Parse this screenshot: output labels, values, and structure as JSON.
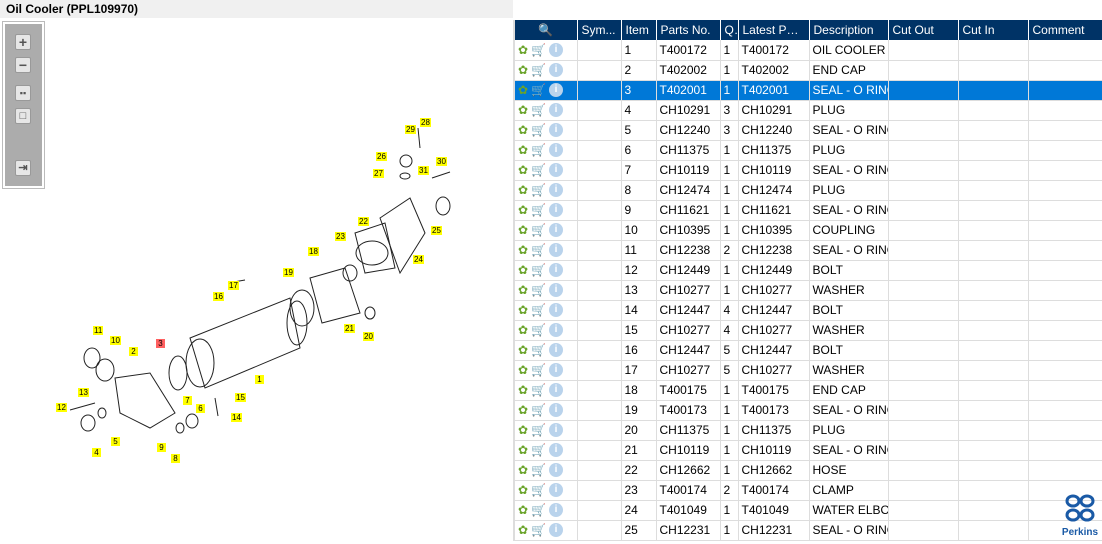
{
  "title": "Oil Cooler (PPL109970)",
  "toolbar": [
    "zoom-in",
    "zoom-out",
    "fit-all",
    "fit-window",
    "export"
  ],
  "callouts": [
    "28",
    "29",
    "26",
    "27",
    "31",
    "30",
    "22",
    "25",
    "23",
    "24",
    "18",
    "19",
    "17",
    "16",
    "21",
    "20",
    "11",
    "10",
    "3",
    "2",
    "1",
    "13",
    "12",
    "7",
    "15",
    "6",
    "5",
    "14",
    "9",
    "4",
    "8"
  ],
  "columns": [
    "",
    "Sym...",
    "Item",
    "Parts No.",
    "Q.",
    "Latest Par...",
    "Description",
    "Cut Out",
    "Cut In",
    "Comment"
  ],
  "selected_item": "3",
  "rows": [
    [
      "1",
      "T400172",
      "1",
      "T400172",
      "OIL COOLER"
    ],
    [
      "2",
      "T402002",
      "1",
      "T402002",
      "END CAP"
    ],
    [
      "3",
      "T402001",
      "1",
      "T402001",
      "SEAL - O RING"
    ],
    [
      "4",
      "CH10291",
      "3",
      "CH10291",
      "PLUG"
    ],
    [
      "5",
      "CH12240",
      "3",
      "CH12240",
      "SEAL - O RING"
    ],
    [
      "6",
      "CH11375",
      "1",
      "CH11375",
      "PLUG"
    ],
    [
      "7",
      "CH10119",
      "1",
      "CH10119",
      "SEAL - O RING"
    ],
    [
      "8",
      "CH12474",
      "1",
      "CH12474",
      "PLUG"
    ],
    [
      "9",
      "CH11621",
      "1",
      "CH11621",
      "SEAL - O RING"
    ],
    [
      "10",
      "CH10395",
      "1",
      "CH10395",
      "COUPLING"
    ],
    [
      "11",
      "CH12238",
      "2",
      "CH12238",
      "SEAL - O RING"
    ],
    [
      "12",
      "CH12449",
      "1",
      "CH12449",
      "BOLT"
    ],
    [
      "13",
      "CH10277",
      "1",
      "CH10277",
      "WASHER"
    ],
    [
      "14",
      "CH12447",
      "4",
      "CH12447",
      "BOLT"
    ],
    [
      "15",
      "CH10277",
      "4",
      "CH10277",
      "WASHER"
    ],
    [
      "16",
      "CH12447",
      "5",
      "CH12447",
      "BOLT"
    ],
    [
      "17",
      "CH10277",
      "5",
      "CH10277",
      "WASHER"
    ],
    [
      "18",
      "T400175",
      "1",
      "T400175",
      "END CAP"
    ],
    [
      "19",
      "T400173",
      "1",
      "T400173",
      "SEAL - O RING"
    ],
    [
      "20",
      "CH11375",
      "1",
      "CH11375",
      "PLUG"
    ],
    [
      "21",
      "CH10119",
      "1",
      "CH10119",
      "SEAL - O RING"
    ],
    [
      "22",
      "CH12662",
      "1",
      "CH12662",
      "HOSE"
    ],
    [
      "23",
      "T400174",
      "2",
      "T400174",
      "CLAMP"
    ],
    [
      "24",
      "T401049",
      "1",
      "T401049",
      "WATER ELBOW"
    ],
    [
      "25",
      "CH12231",
      "1",
      "CH12231",
      "SEAL - O RING"
    ]
  ],
  "logo_text": "Perkins"
}
